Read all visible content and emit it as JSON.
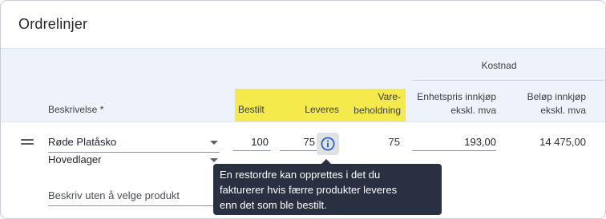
{
  "panel": {
    "title": "Ordrelinjer"
  },
  "columns": {
    "group_cost": "Kostnad",
    "description": "Beskrivelse *",
    "ordered": "Bestilt",
    "delivered": "Leveres",
    "stock_line1": "Vare-",
    "stock_line2": "beholdning",
    "unit_price_line1": "Enhetspris innkjøp",
    "unit_price_line2": "ekskl. mva",
    "amount_line1": "Beløp innkjøp",
    "amount_line2": "ekskl. mva"
  },
  "row": {
    "product": "Røde Platåsko",
    "warehouse": "Hovedlager",
    "ordered": "100",
    "delivered": "75",
    "stock": "75",
    "unit_price": "193,00",
    "amount": "14 475,00",
    "free_text_placeholder": "Beskriv uten å velge produkt"
  },
  "tooltip": {
    "line1": "En restordre kan opprettes i det du",
    "line2": "fakturerer hvis færre produkter leveres",
    "line3": "enn det som ble bestilt."
  },
  "colors": {
    "highlight": "#f4ea4c",
    "header_band": "#eef2fb",
    "tooltip_bg": "#283041",
    "info_icon": "#1b58c9"
  },
  "icons": {
    "drag": "drag-handle-icon",
    "info": "info-icon",
    "dropdown": "chevron-down-icon"
  }
}
